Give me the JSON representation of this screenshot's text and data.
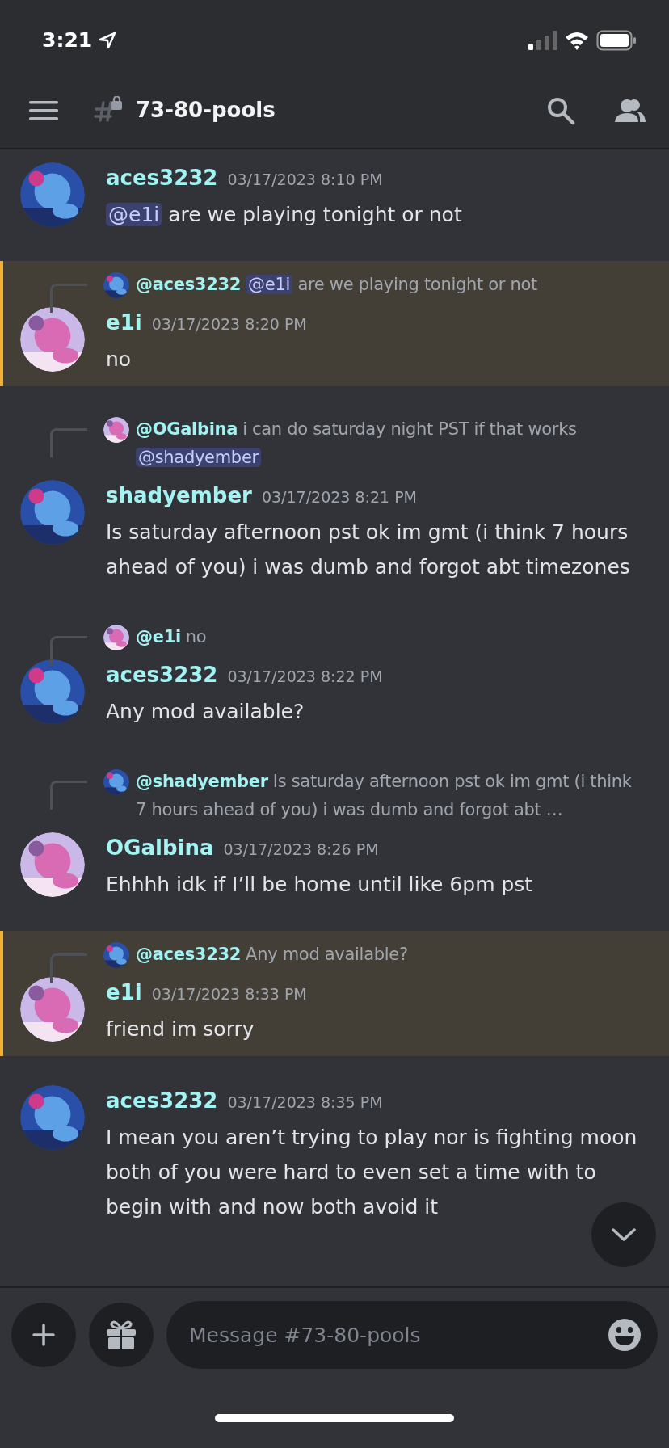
{
  "status_bar": {
    "time": "3:21"
  },
  "header": {
    "channel": "73-80-pools"
  },
  "messages": [
    {
      "author": "aces3232",
      "time": "03/17/2023 8:10 PM",
      "highlighted": false,
      "content": [
        {
          "kind": "mention",
          "text": "@e1i"
        },
        {
          "kind": "text",
          "text": " are we playing tonight or not"
        }
      ]
    },
    {
      "author": "e1i",
      "time": "03/17/2023 8:20 PM",
      "highlighted": true,
      "reply": {
        "author": "@aces3232",
        "content": [
          {
            "kind": "mention",
            "text": "@e1i"
          },
          {
            "kind": "text",
            "text": " are we playing tonight or not"
          }
        ]
      },
      "content": [
        {
          "kind": "text",
          "text": "no"
        }
      ]
    },
    {
      "author": "shadyember",
      "time": "03/17/2023 8:21 PM",
      "highlighted": false,
      "reply": {
        "author": "@OGalbina",
        "content": [
          {
            "kind": "text",
            "text": "i can do saturday night PST if that works "
          },
          {
            "kind": "mention",
            "text": "@shadyember"
          }
        ]
      },
      "content": [
        {
          "kind": "text",
          "text": "Is saturday afternoon pst ok im gmt (i think 7 hours ahead of you) i was dumb and forgot abt timezones"
        }
      ]
    },
    {
      "author": "aces3232",
      "time": "03/17/2023 8:22 PM",
      "highlighted": false,
      "reply": {
        "author": "@e1i",
        "content": [
          {
            "kind": "text",
            "text": "no"
          }
        ]
      },
      "content": [
        {
          "kind": "text",
          "text": "Any mod available?"
        }
      ]
    },
    {
      "author": "OGalbina",
      "time": "03/17/2023 8:26 PM",
      "highlighted": false,
      "reply": {
        "author": "@shadyember",
        "content": [
          {
            "kind": "text",
            "text": "Is saturday afternoon pst ok im gmt (i think 7 hours ahead of you) i was dumb and forgot abt …"
          }
        ]
      },
      "content": [
        {
          "kind": "text",
          "text": "Ehhhh idk if I’ll be home until like 6pm pst"
        }
      ]
    },
    {
      "author": "e1i",
      "time": "03/17/2023 8:33 PM",
      "highlighted": true,
      "reply": {
        "author": "@aces3232",
        "content": [
          {
            "kind": "text",
            "text": "Any mod available?"
          }
        ]
      },
      "content": [
        {
          "kind": "text",
          "text": "friend im sorry"
        }
      ]
    },
    {
      "author": "aces3232",
      "time": "03/17/2023 8:35 PM",
      "highlighted": false,
      "content": [
        {
          "kind": "text",
          "text": "I mean you aren’t trying to play nor is fighting moon both of you were hard to even set a time with to begin with and now both avoid it"
        }
      ]
    }
  ],
  "composer": {
    "placeholder": "Message #73-80-pools"
  }
}
